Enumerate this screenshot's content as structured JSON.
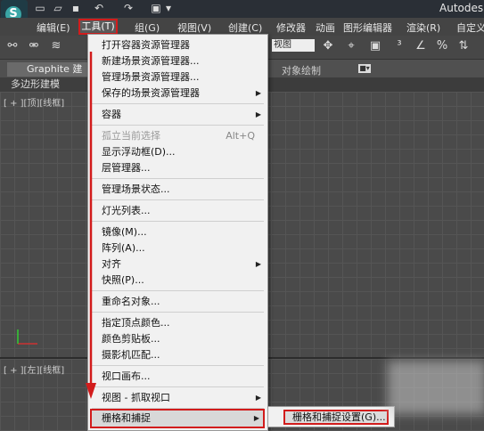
{
  "title_bar": {
    "app_title": "Autodesk"
  },
  "menu_bar": {
    "items": [
      "编辑(E)",
      "工具(T)",
      "组(G)",
      "视图(V)",
      "创建(C)",
      "修改器",
      "动画",
      "图形编辑器",
      "渲染(R)",
      "自定义"
    ]
  },
  "toolbar": {
    "view_select": "视图"
  },
  "ribbon": {
    "tab_label": "Graphite 建",
    "object_paint": "对象绘制",
    "poly_modeling": "多边形建模"
  },
  "viewports": {
    "top_label": "[ + ][顶][线框]",
    "left_label": "[ + ][左][线框]"
  },
  "tools_menu": {
    "items": [
      {
        "label": "打开容器资源管理器"
      },
      {
        "label": "新建场景资源管理器..."
      },
      {
        "label": "管理场景资源管理器..."
      },
      {
        "label": "保存的场景资源管理器",
        "submenu": true
      },
      {
        "label": "容器",
        "submenu": true
      },
      {
        "label": "孤立当前选择",
        "shortcut": "Alt+Q",
        "disabled": true
      },
      {
        "label": "显示浮动框(D)..."
      },
      {
        "label": "层管理器..."
      },
      {
        "label": "管理场景状态..."
      },
      {
        "label": "灯光列表..."
      },
      {
        "label": "镜像(M)..."
      },
      {
        "label": "阵列(A)..."
      },
      {
        "label": "对齐",
        "submenu": true
      },
      {
        "label": "快照(P)..."
      },
      {
        "label": "重命名对象..."
      },
      {
        "label": "指定顶点颜色..."
      },
      {
        "label": "颜色剪贴板..."
      },
      {
        "label": "摄影机匹配..."
      },
      {
        "label": "视口画布..."
      },
      {
        "label": "视图 - 抓取视口",
        "submenu": true
      },
      {
        "label": "栅格和捕捉",
        "submenu": true,
        "highlighted": true
      }
    ]
  },
  "grid_submenu": {
    "item": "栅格和捕捉设置(G)..."
  },
  "colors": {
    "annotation_red": "#d21c1c",
    "menu_bg": "#f1f1f1"
  }
}
